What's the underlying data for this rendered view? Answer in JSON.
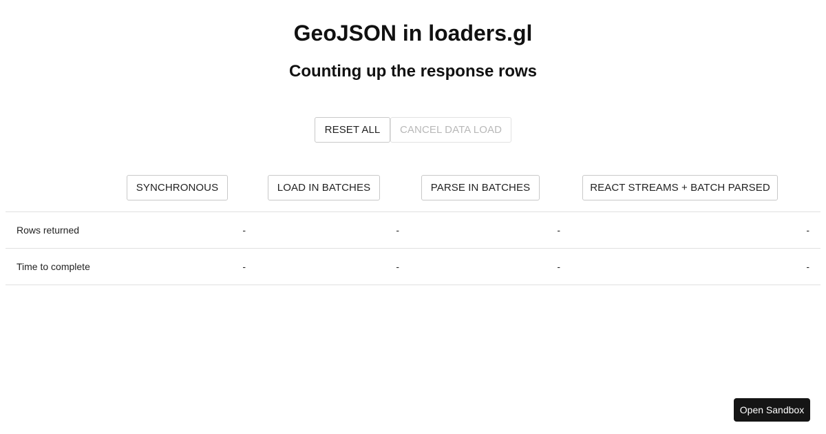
{
  "header": {
    "title": "GeoJSON in loaders.gl",
    "subtitle": "Counting up the response rows"
  },
  "controls": {
    "reset_label": "RESET ALL",
    "cancel_label": "CANCEL DATA LOAD"
  },
  "columns": [
    {
      "label": "SYNCHRONOUS"
    },
    {
      "label": "LOAD IN BATCHES"
    },
    {
      "label": "PARSE IN BATCHES"
    },
    {
      "label": "REACT STREAMS + BATCH PARSED"
    }
  ],
  "rows": [
    {
      "label": "Rows returned",
      "values": [
        "-",
        "-",
        "-",
        "-"
      ]
    },
    {
      "label": "Time to complete",
      "values": [
        "-",
        "-",
        "-",
        "-"
      ]
    }
  ],
  "footer": {
    "sandbox_label": "Open Sandbox"
  }
}
